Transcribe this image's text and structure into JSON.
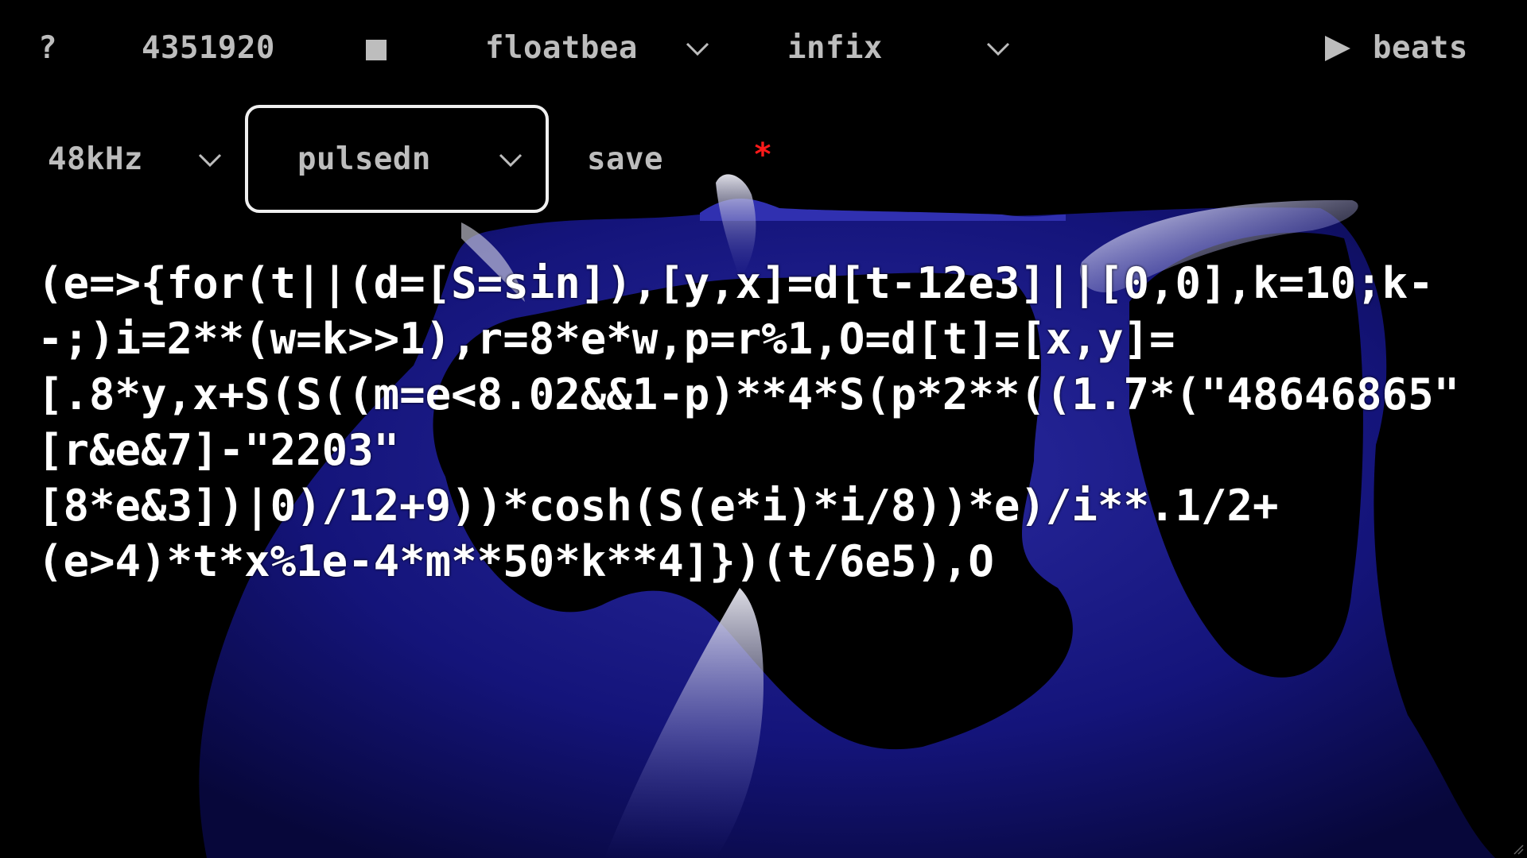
{
  "toolbar": {
    "help_label": "?",
    "time_counter": "4351920",
    "mode_select": "floatbeat",
    "syntax_select": "infix",
    "play_label": "beats",
    "sample_rate_select": "48kHz",
    "song_select": "pulsedn",
    "save_label": "save",
    "unsaved_marker": "*"
  },
  "code": {
    "lines": [
      "(e=>{for(t||(d=[S=sin]),[y,x]=d[t-12e3]||[0,0],k=10;k-",
      "-;)i=2**(w=k>>1),r=8*e*w,p=r%1,O=d[t]=[x,y]=",
      "[.8*y,x+S(S((m=e<8.02&&1-p)**4*S(p*2**((1.7*(\"48646865\"",
      "[r&e&7]-\"2203\"",
      "[8*e&3])|0)/12+9))*cosh(S(e*i)*i/8))*e)/i**.1/2+",
      "(e>4)*t*x%1e-4*m**50*k**4]})(t/6e5),O"
    ]
  },
  "colors": {
    "background": "#000000",
    "text": "#ffffff",
    "toolbar_text": "#bdbdbd",
    "viz_dark_blue": "#0a0a5a",
    "viz_blue": "#2a2aa0",
    "viz_highlight": "#e8e8f0",
    "unsaved": "#ff1a1a",
    "spell_error": "#e02020"
  },
  "icons": {
    "play": "play-triangle-icon",
    "stop": "stop-square-icon",
    "dropdown": "chevron-down-icon"
  }
}
